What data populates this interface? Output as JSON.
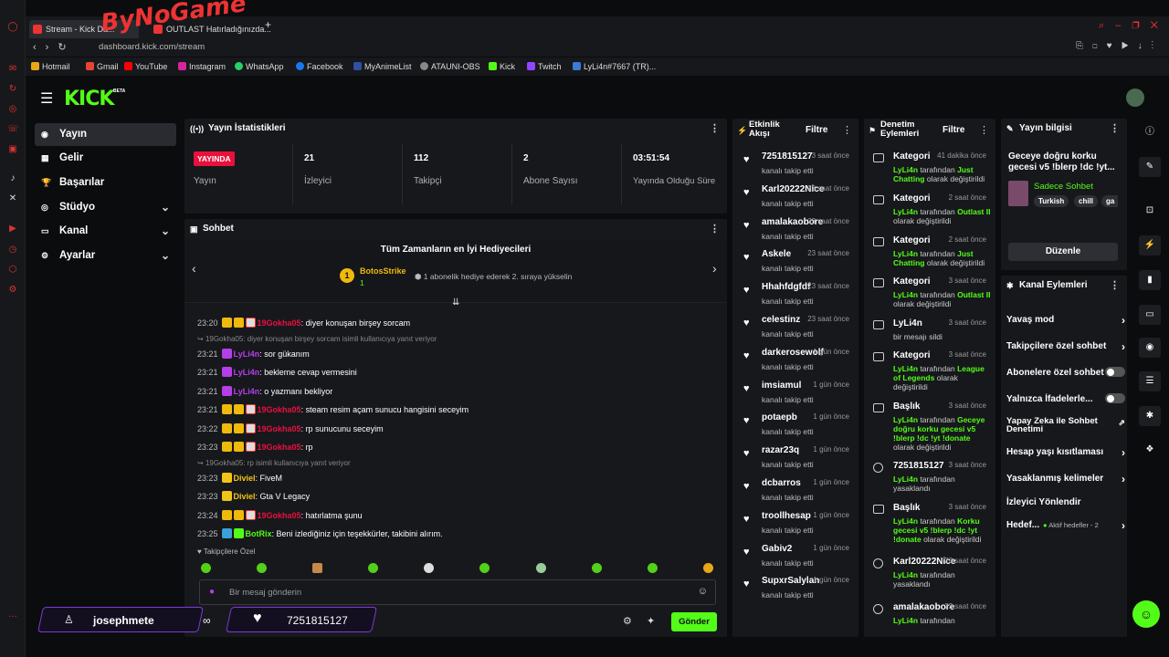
{
  "browser": {
    "tabs": [
      {
        "label": "Stream - Kick Da..."
      },
      {
        "label": "OUTLAST Hatırladığınızda..."
      }
    ],
    "url": "dashboard.kick.com/stream",
    "watermark": "ByNoGame",
    "bookmarks": [
      "Hotmail",
      "Gmail",
      "YouTube",
      "Instagram",
      "WhatsApp",
      "Facebook",
      "MyAnimeList",
      "ATAUNI-OBS",
      "Kick",
      "Twitch",
      "LyLi4n#7667 (TR)..."
    ]
  },
  "app": {
    "logo": "KICK",
    "logo_badge": "BETA",
    "accent": "#53fc18"
  },
  "sidebar": {
    "items": [
      {
        "label": "Yayın",
        "icon": "broadcast-icon"
      },
      {
        "label": "Gelir",
        "icon": "revenue-icon"
      },
      {
        "label": "Başarılar",
        "icon": "trophy-icon"
      },
      {
        "label": "Stüdyo",
        "icon": "studio-icon"
      },
      {
        "label": "Kanal",
        "icon": "channel-icon"
      },
      {
        "label": "Ayarlar",
        "icon": "gear-icon"
      }
    ]
  },
  "stats": {
    "title": "Yayın İstatistikleri",
    "live_badge": "YAYINDA",
    "live_label": "Yayın",
    "items": [
      {
        "value": "21",
        "label": "İzleyici"
      },
      {
        "value": "112",
        "label": "Takipçi"
      },
      {
        "value": "2",
        "label": "Abone Sayısı"
      },
      {
        "value": "03:51:54",
        "label": "Yayında Olduğu Süre"
      }
    ]
  },
  "chat": {
    "title": "Sohbet",
    "gifters_title": "Tüm Zamanların en İyi Hediyecileri",
    "top_gifter": "BotosStrike",
    "top_gifter_count": "1",
    "gifter_note": "1 abonelik hediye ederek 2. sıraya yükselin",
    "lines": [
      {
        "type": "msg",
        "time": "23:20",
        "user": "19Gokha05",
        "color": "#e8113c",
        "badges": 3,
        "text": ": diyer konuşan birşey sorcam"
      },
      {
        "type": "reply",
        "text": "19Gokha05: diyer konuşan birşey sorcam isimli kullanıcıya yanıt veriyor"
      },
      {
        "type": "msg",
        "time": "23:21",
        "user": "LyLi4n",
        "color": "#b43ee8",
        "badges": 1,
        "text": ": sor gükanım"
      },
      {
        "type": "msg",
        "time": "23:21",
        "user": "LyLi4n",
        "color": "#b43ee8",
        "badges": 1,
        "text": ": bekleme cevap vermesini"
      },
      {
        "type": "msg",
        "time": "23:21",
        "user": "LyLi4n",
        "color": "#b43ee8",
        "badges": 1,
        "text": ": o yazmanı bekliyor"
      },
      {
        "type": "msg",
        "time": "23:21",
        "user": "19Gokha05",
        "color": "#e8113c",
        "badges": 3,
        "text": ": steam resim açam sunucu hangisini seceyim"
      },
      {
        "type": "msg",
        "time": "23:22",
        "user": "19Gokha05",
        "color": "#e8113c",
        "badges": 3,
        "text": ": rp sunucunu seceyim"
      },
      {
        "type": "msg",
        "time": "23:23",
        "user": "19Gokha05",
        "color": "#e8113c",
        "badges": 3,
        "text": ": rp"
      },
      {
        "type": "reply",
        "text": "19Gokha05: rp isimli kullanıcıya yanıt veriyor"
      },
      {
        "type": "msg",
        "time": "23:23",
        "user": "Diviel",
        "color": "#f0c419",
        "badges": 1,
        "text": ": FiveM"
      },
      {
        "type": "msg",
        "time": "23:23",
        "user": "Diviel",
        "color": "#f0c419",
        "badges": 1,
        "text": ": Gta V Legacy"
      },
      {
        "type": "msg",
        "time": "23:24",
        "user": "19Gokha05",
        "color": "#e8113c",
        "badges": 3,
        "text": ": hatırlatma şunu"
      },
      {
        "type": "msg",
        "time": "23:25",
        "user": "BotRix",
        "color": "#53fc18",
        "badges": 2,
        "text": ": Beni izlediğiniz için teşekkürler, takibini alırım."
      }
    ],
    "followers_only": "Takipçilere Özel",
    "input_placeholder": "Bir mesaj gönderin",
    "send_label": "Gönder"
  },
  "overlay": {
    "user": "josephmete",
    "infinity": "∞",
    "follower": "7251815127"
  },
  "activity": {
    "title": "Etkinlik Akışı",
    "filter": "Filtre",
    "items": [
      {
        "name": "7251815127",
        "when": "3 saat önce",
        "desc": "kanalı takip etti"
      },
      {
        "name": "Karl20222Nice",
        "when": "23 saat önce",
        "desc": "kanalı takip etti"
      },
      {
        "name": "amalakaobore",
        "when": "23 saat önce",
        "desc": "kanalı takip etti"
      },
      {
        "name": "Askele",
        "when": "23 saat önce",
        "desc": "kanalı takip etti"
      },
      {
        "name": "Hhahfdgfdf",
        "when": "23 saat önce",
        "desc": "kanalı takip etti"
      },
      {
        "name": "celestinz",
        "when": "23 saat önce",
        "desc": "kanalı takip etti"
      },
      {
        "name": "darkerosewolf",
        "when": "1 gün önce",
        "desc": "kanalı takip etti"
      },
      {
        "name": "imsiamul",
        "when": "1 gün önce",
        "desc": "kanalı takip etti"
      },
      {
        "name": "potaepb",
        "when": "1 gün önce",
        "desc": "kanalı takip etti"
      },
      {
        "name": "razar23q",
        "when": "1 gün önce",
        "desc": "kanalı takip etti"
      },
      {
        "name": "dcbarros",
        "when": "1 gün önce",
        "desc": "kanalı takip etti"
      },
      {
        "name": "troollhesap",
        "when": "1 gün önce",
        "desc": "kanalı takip etti"
      },
      {
        "name": "Gabiv2",
        "when": "1 gün önce",
        "desc": "kanalı takip etti"
      },
      {
        "name": "SupxrSalylan",
        "when": "1 gün önce",
        "desc": "kanalı takip etti"
      }
    ]
  },
  "moderation": {
    "title": "Denetim Eylemleri",
    "filter": "Filtre",
    "items": [
      {
        "name": "Kategori",
        "when": "41 dakika önce",
        "actor": "LyLi4n",
        "pre": " tarafından ",
        "hl": "Just Chatting",
        "post": " olarak değiştirildi"
      },
      {
        "name": "Kategori",
        "when": "2 saat önce",
        "actor": "LyLi4n",
        "pre": " tarafından ",
        "hl": "Outlast II",
        "post": " olarak değiştirildi"
      },
      {
        "name": "Kategori",
        "when": "2 saat önce",
        "actor": "LyLi4n",
        "pre": " tarafından ",
        "hl": "Just Chatting",
        "post": " olarak değiştirildi"
      },
      {
        "name": "Kategori",
        "when": "3 saat önce",
        "actor": "LyLi4n",
        "pre": " tarafından ",
        "hl": "Outlast II",
        "post": " olarak değiştirildi"
      },
      {
        "name": "LyLi4n",
        "when": "3 saat önce",
        "actor": "",
        "pre": "bir mesajı sildi",
        "hl": "",
        "post": ""
      },
      {
        "name": "Kategori",
        "when": "3 saat önce",
        "actor": "LyLi4n",
        "pre": " tarafından ",
        "hl": "League of Legends",
        "post": " olarak değiştirildi"
      },
      {
        "name": "Başlık",
        "when": "3 saat önce",
        "actor": "LyLi4n",
        "pre": " tarafından ",
        "hl": "Geceye doğru korku gecesi v5 !blerp !dc !yt !donate",
        "post": " olarak değiştirildi"
      },
      {
        "name": "7251815127",
        "when": "3 saat önce",
        "actor": "LyLi4n",
        "pre": " tarafından yasaklandı",
        "hl": "",
        "post": ""
      },
      {
        "name": "Başlık",
        "when": "3 saat önce",
        "actor": "LyLi4n",
        "pre": " tarafından ",
        "hl": "Korku gecesi v5 !blerp !dc !yt !donate",
        "post": " olarak değiştirildi"
      },
      {
        "name": "Karl20222Nice",
        "when": "23 saat önce",
        "actor": "LyLi4n",
        "pre": " tarafından yasaklandı",
        "hl": "",
        "post": ""
      },
      {
        "name": "amalakaobore",
        "when": "23 saat önce",
        "actor": "LyLi4n",
        "pre": " tarafından",
        "hl": "",
        "post": ""
      }
    ]
  },
  "stream_info": {
    "title": "Yayın bilgisi",
    "stream_title": "Geceye doğru korku gecesi v5 !blerp !dc !yt...",
    "category": "Sadece Sohbet",
    "tags": [
      "Turkish",
      "chill",
      "ga"
    ],
    "edit": "Düzenle"
  },
  "channel_actions": {
    "title": "Kanal Eylemleri",
    "items": [
      {
        "label": "Yavaş mod",
        "kind": "chev"
      },
      {
        "label": "Takipçilere özel sohbet",
        "kind": "chev"
      },
      {
        "label": "Abonelere özel sohbet",
        "kind": "toggle"
      },
      {
        "label": "Yalnızca İfadelerle...",
        "kind": "toggle"
      },
      {
        "label": "Yapay Zeka ile Sohbet Denetimi",
        "kind": "ext"
      },
      {
        "label": "Hesap yaşı kısıtlaması",
        "kind": "chev"
      },
      {
        "label": "Yasaklanmış kelimeler",
        "kind": "chev"
      },
      {
        "label": "İzleyici Yönlendir",
        "kind": "none"
      },
      {
        "label": "Hedef...",
        "kind": "chev"
      }
    ],
    "goals_note": "Aktif hedefler - 2"
  }
}
